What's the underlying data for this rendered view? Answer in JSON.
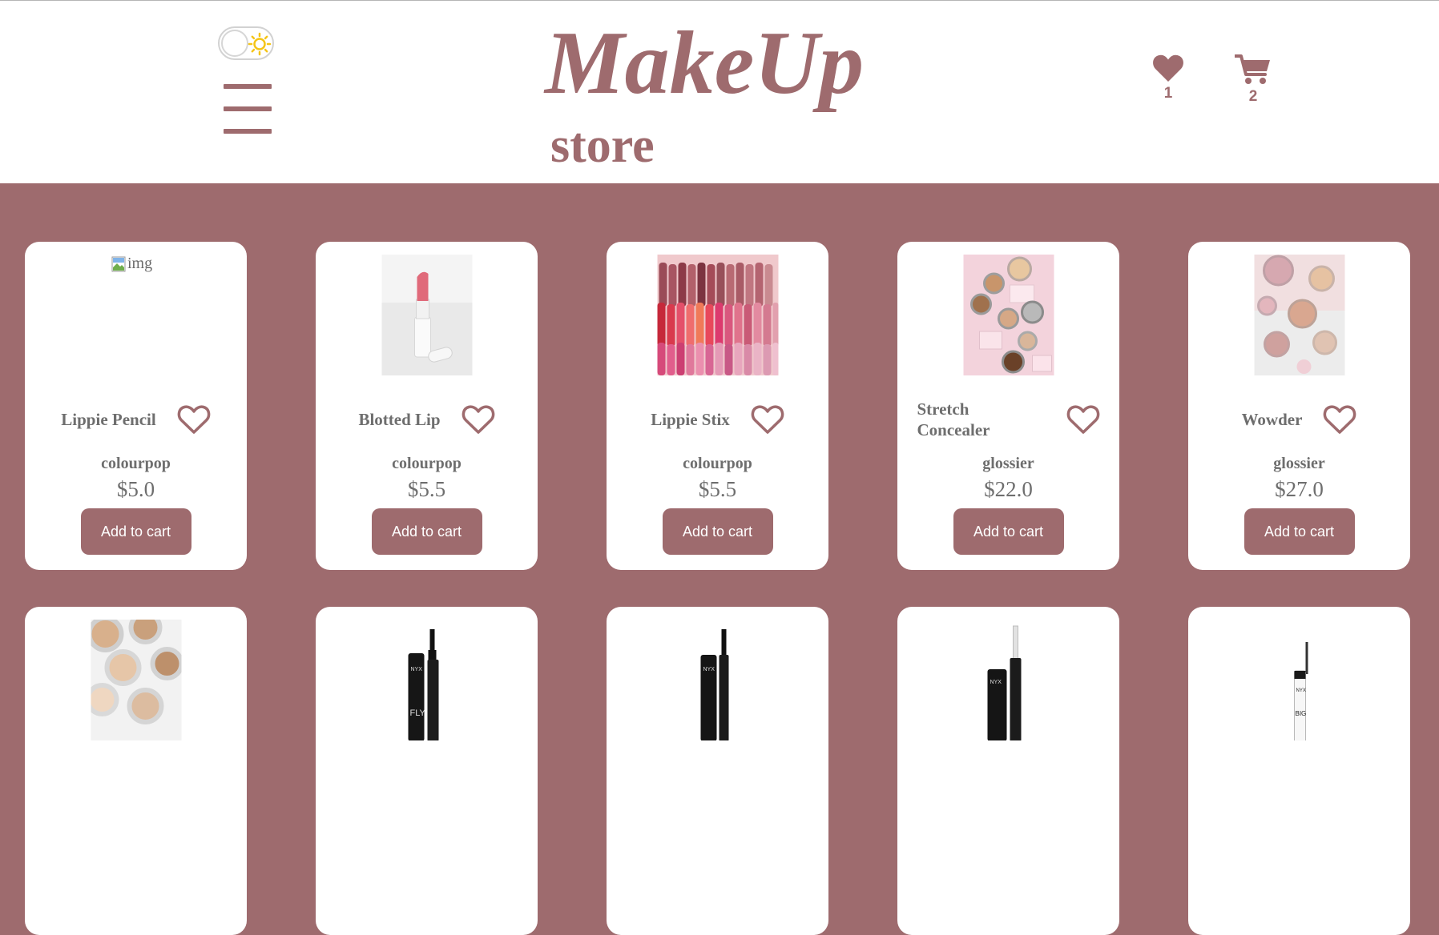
{
  "colors": {
    "brand": "#9e6b6e",
    "text": "#6e6e6e",
    "card": "#ffffff",
    "sun": "#f5c518"
  },
  "header": {
    "title": "MakeUp",
    "subtitle": "store",
    "theme_toggle": {
      "state": "light",
      "icon": "sun-icon"
    },
    "menu_icon": "hamburger-icon",
    "wishlist": {
      "icon": "heart-icon",
      "count": "1"
    },
    "cart": {
      "icon": "cart-icon",
      "count": "2"
    }
  },
  "products": [
    {
      "name": "Lippie Pencil",
      "brand": "colourpop",
      "price": "$5.0",
      "button": "Add to cart",
      "image_alt": "img",
      "image_broken": true
    },
    {
      "name": "Blotted Lip",
      "brand": "colourpop",
      "price": "$5.5",
      "button": "Add to cart",
      "image": "lipstick-white-tube"
    },
    {
      "name": "Lippie Stix",
      "brand": "colourpop",
      "price": "$5.5",
      "button": "Add to cart",
      "image": "lipstick-rows"
    },
    {
      "name": "Stretch Concealer",
      "brand": "glossier",
      "price": "$22.0",
      "button": "Add to cart",
      "image": "concealer-jars"
    },
    {
      "name": "Wowder",
      "brand": "glossier",
      "price": "$27.0",
      "button": "Add to cart",
      "image": "powder-compacts"
    }
  ],
  "products_row2": [
    {
      "image": "concealer-sticks"
    },
    {
      "image": "mascara-fly"
    },
    {
      "image": "mascara-lengthening"
    },
    {
      "image": "mascara-proof"
    },
    {
      "image": "brow-gel-big"
    }
  ]
}
